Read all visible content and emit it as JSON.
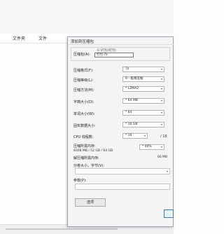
{
  "background": {
    "columns": [
      "文件夹",
      "文件"
    ]
  },
  "dialog": {
    "title": "添加到压缩包",
    "archive_label": "压缩包(A):",
    "archive_path": "E:\\打包\\打包\\",
    "archive_name": "打包.7z",
    "format": {
      "label": "压缩格式(F):",
      "value": "7z"
    },
    "level": {
      "label": "压缩等级(L):",
      "value": "9 - 极限压缩"
    },
    "method": {
      "label": "压缩方法(M):",
      "value": "* LZMA2"
    },
    "dict": {
      "label": "字典大小(D):",
      "value": "* 64 MB"
    },
    "word": {
      "label": "单词大小(W):",
      "value": "* 64"
    },
    "solid": {
      "label": "固实数据大小:",
      "value": "* 16 GB"
    },
    "threads": {
      "label": "CPU 线程数:",
      "value": "* 16",
      "total": "/ 16"
    },
    "mem_compress": {
      "label": "压缩所需内存:",
      "detail": "8308 MB / 52 GB / 64 GB",
      "value": "* 40%"
    },
    "mem_decompress": {
      "label": "解压缩所需内存:",
      "value": "66 MB"
    },
    "split_label": "分卷大小，字节(V):",
    "params_label": "参数(P):",
    "options_button": "选项"
  }
}
